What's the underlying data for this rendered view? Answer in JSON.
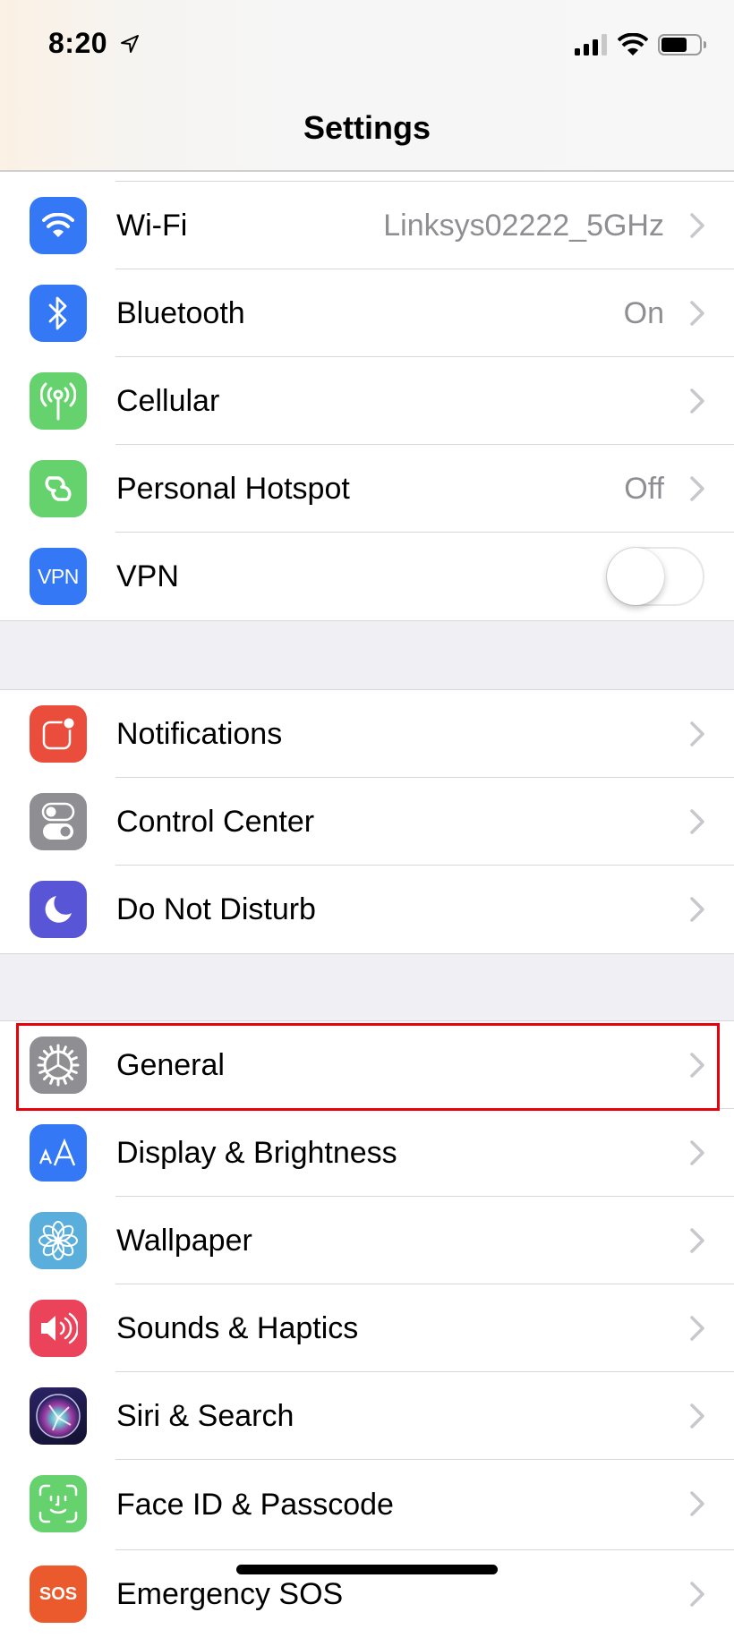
{
  "status_bar": {
    "time": "8:20",
    "icons": [
      "location-arrow-icon",
      "cellular-signal-icon",
      "wifi-icon",
      "battery-icon"
    ]
  },
  "header": {
    "title": "Settings"
  },
  "sections": [
    {
      "rows": [
        {
          "label": "Wi-Fi",
          "value": "Linksys02222_5GHz",
          "icon": "wifi-icon",
          "color": "#3478f6",
          "accessory": "chevron"
        },
        {
          "label": "Bluetooth",
          "value": "On",
          "icon": "bluetooth-icon",
          "color": "#3478f6",
          "accessory": "chevron"
        },
        {
          "label": "Cellular",
          "value": "",
          "icon": "cellular-antenna-icon",
          "color": "#65d26e",
          "accessory": "chevron"
        },
        {
          "label": "Personal Hotspot",
          "value": "Off",
          "icon": "hotspot-chain-icon",
          "color": "#65d26e",
          "accessory": "chevron"
        },
        {
          "label": "VPN",
          "value": "",
          "icon": "vpn-icon",
          "icon_text": "VPN",
          "color": "#3478f6",
          "accessory": "toggle",
          "toggle_on": false
        }
      ]
    },
    {
      "rows": [
        {
          "label": "Notifications",
          "value": "",
          "icon": "notifications-icon",
          "color": "#eb4d3d",
          "accessory": "chevron"
        },
        {
          "label": "Control Center",
          "value": "",
          "icon": "control-center-icon",
          "color": "#8e8e93",
          "accessory": "chevron"
        },
        {
          "label": "Do Not Disturb",
          "value": "",
          "icon": "moon-icon",
          "color": "#5856d6",
          "accessory": "chevron"
        }
      ]
    },
    {
      "rows": [
        {
          "label": "General",
          "value": "",
          "icon": "gear-icon",
          "color": "#8e8e93",
          "accessory": "chevron",
          "highlighted": true
        },
        {
          "label": "Display & Brightness",
          "value": "",
          "icon": "display-text-size-icon",
          "icon_text": "AA",
          "color": "#3478f6",
          "accessory": "chevron"
        },
        {
          "label": "Wallpaper",
          "value": "",
          "icon": "wallpaper-flower-icon",
          "color": "#5aaedb",
          "accessory": "chevron"
        },
        {
          "label": "Sounds & Haptics",
          "value": "",
          "icon": "speaker-icon",
          "color": "#eb445a",
          "accessory": "chevron"
        },
        {
          "label": "Siri & Search",
          "value": "",
          "icon": "siri-icon",
          "color": "#1d1b4a",
          "accessory": "chevron"
        },
        {
          "label": "Face ID & Passcode",
          "value": "",
          "icon": "face-id-icon",
          "color": "#65d26e",
          "accessory": "chevron"
        },
        {
          "label": "Emergency SOS",
          "value": "",
          "icon": "sos-icon",
          "color": "#eb5a2c",
          "accessory": "chevron",
          "partially_visible": true
        }
      ]
    }
  ],
  "highlight": {
    "target": "General",
    "color": "#e8000b"
  }
}
